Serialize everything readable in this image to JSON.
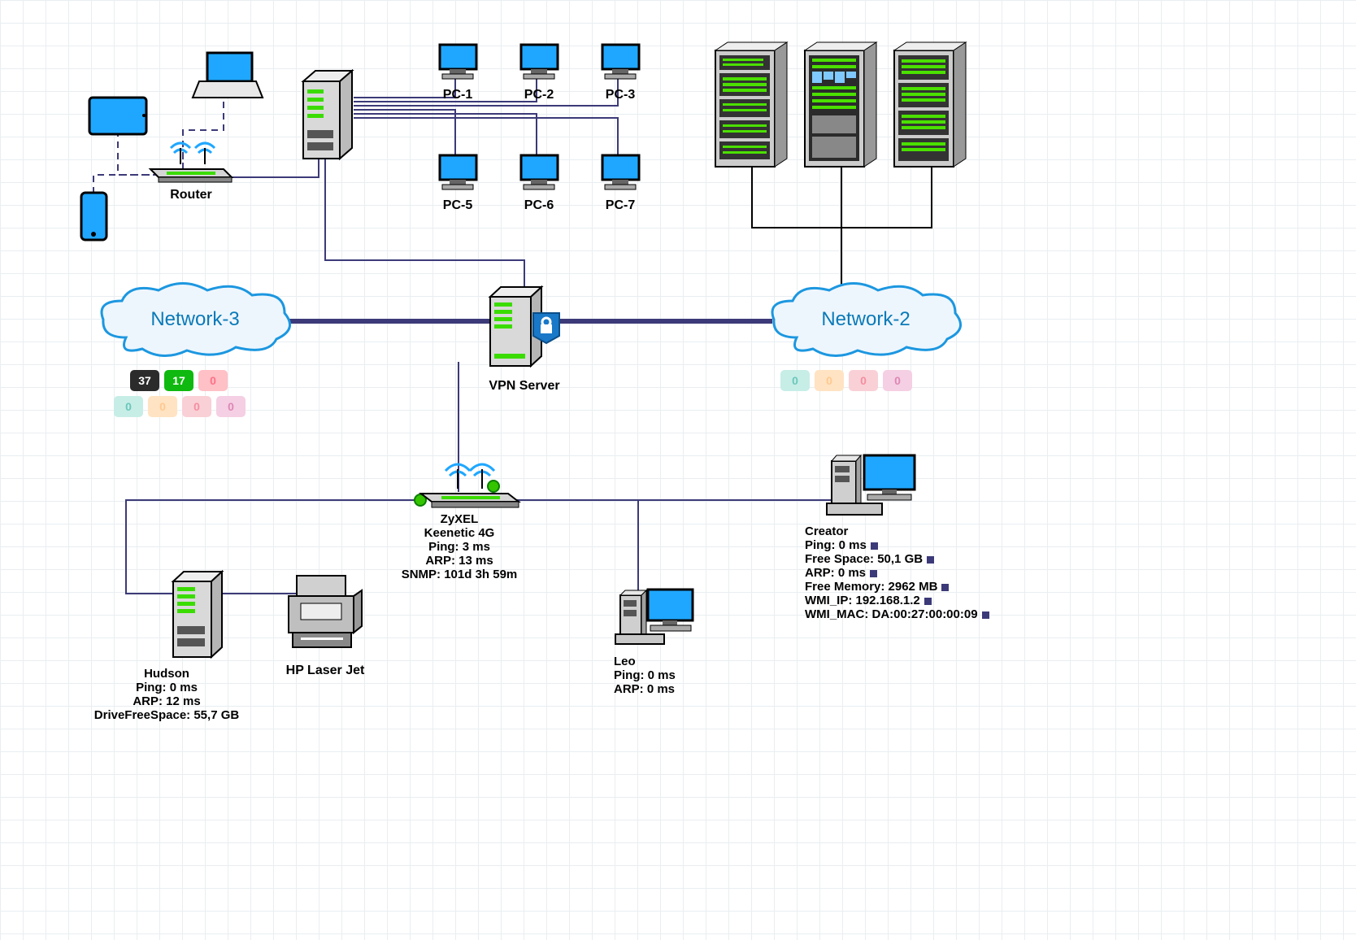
{
  "pcs": {
    "pc1": "PC-1",
    "pc2": "PC-2",
    "pc3": "PC-3",
    "pc5": "PC-5",
    "pc6": "PC-6",
    "pc7": "PC-7"
  },
  "router": {
    "label": "Router"
  },
  "network3": {
    "label": "Network-3",
    "row1": [
      {
        "v": "37",
        "c": "dark"
      },
      {
        "v": "17",
        "c": "green"
      },
      {
        "v": "0",
        "c": "red"
      }
    ],
    "row2": [
      {
        "v": "0",
        "c": "teal"
      },
      {
        "v": "0",
        "c": "orange"
      },
      {
        "v": "0",
        "c": "redf"
      },
      {
        "v": "0",
        "c": "pink"
      }
    ]
  },
  "network2": {
    "label": "Network-2",
    "row": [
      {
        "v": "0",
        "c": "teal"
      },
      {
        "v": "0",
        "c": "orange"
      },
      {
        "v": "0",
        "c": "redf"
      },
      {
        "v": "0",
        "c": "pink"
      }
    ]
  },
  "vpn": {
    "label": "VPN Server"
  },
  "zyxel": {
    "l1": "ZyXEL",
    "l2": "Keenetic 4G",
    "l3": "Ping: 3 ms",
    "l4": "ARP: 13 ms",
    "l5": "SNMP: 101d 3h 59m"
  },
  "hudson": {
    "l1": "Hudson",
    "l2": "Ping: 0 ms",
    "l3": "ARP: 12 ms",
    "l4": "DriveFreeSpace: 55,7 GB"
  },
  "printer": {
    "label": "HP Laser Jet"
  },
  "leo": {
    "l1": "Leo",
    "l2": "Ping: 0 ms",
    "l3": "ARP: 0 ms"
  },
  "creator": {
    "l1": "Creator",
    "l2": "Ping: 0 ms",
    "l3": "Free Space: 50,1 GB",
    "l4": "ARP: 0 ms",
    "l5": "Free Memory: 2962 MB",
    "l6": "WMI_IP: 192.168.1.2",
    "l7": "WMI_MAC: DA:00:27:00:00:09"
  }
}
